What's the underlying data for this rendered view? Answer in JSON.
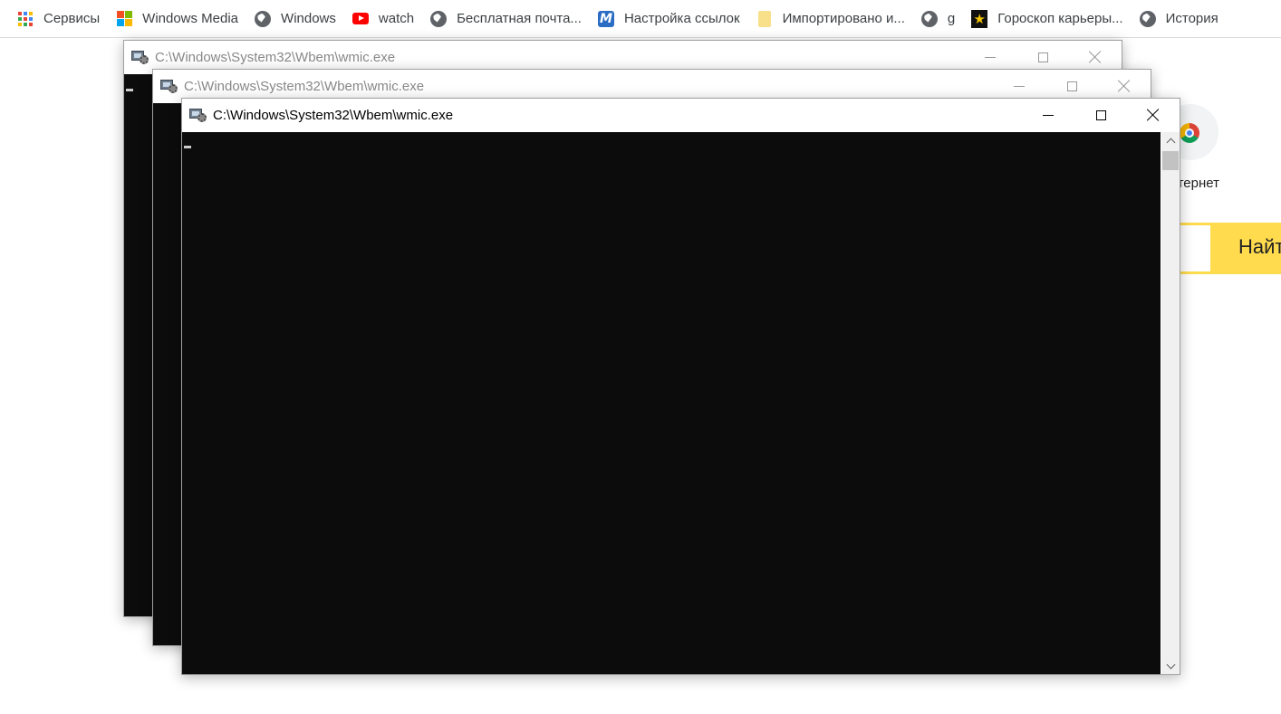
{
  "bookmarks": [
    {
      "label": "Сервисы",
      "icon": "apps-grid-icon"
    },
    {
      "label": "Windows Media",
      "icon": "windows-logo-icon"
    },
    {
      "label": "Windows",
      "icon": "globe-icon"
    },
    {
      "label": "watch",
      "icon": "youtube-icon"
    },
    {
      "label": "Бесплатная почта...",
      "icon": "globe-icon"
    },
    {
      "label": "Настройка ссылок",
      "icon": "m-logo-icon"
    },
    {
      "label": "Импортировано и...",
      "icon": "folder-icon"
    },
    {
      "label": "g",
      "icon": "globe-icon"
    },
    {
      "label": "Гороскоп карьеры...",
      "icon": "star-icon"
    },
    {
      "label": "История",
      "icon": "globe-icon"
    }
  ],
  "background_page": {
    "tile_label_fragment": "тернет",
    "search_button_fragment": "Найт"
  },
  "windows": [
    {
      "title": "C:\\Windows\\System32\\Wbem\\wmic.exe",
      "state": "inactive"
    },
    {
      "title": "C:\\Windows\\System32\\Wbem\\wmic.exe",
      "state": "inactive"
    },
    {
      "title": "C:\\Windows\\System32\\Wbem\\wmic.exe",
      "state": "active"
    }
  ],
  "colors": {
    "console_background": "#0c0c0c",
    "search_accent": "#ffdb4d"
  }
}
